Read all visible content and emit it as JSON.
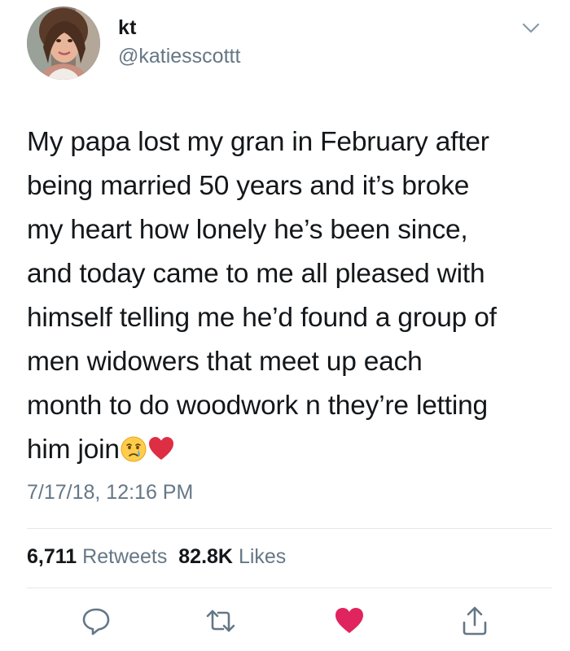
{
  "user": {
    "name": "kt",
    "handle": "@katiesscottt"
  },
  "tweet": {
    "lines": [
      "My papa lost my gran in February after",
      "being married 50 years and it’s broke",
      "my heart how lonely he’s been since,",
      "and today came to me all pleased with",
      "himself telling me he’d found a group of",
      "men widowers that meet up each",
      "month to do woodwork n they’re letting",
      "him join"
    ],
    "emojis": [
      "crying-face",
      "red-heart"
    ],
    "timestamp": "7/17/18, 12:16 PM"
  },
  "stats": {
    "retweets_count": "6,711",
    "retweets_label": "Retweets",
    "likes_count": "82.8K",
    "likes_label": "Likes"
  },
  "actions": {
    "reply_icon": "reply-icon",
    "retweet_icon": "retweet-icon",
    "like_icon": "heart-icon",
    "share_icon": "share-icon",
    "like_active": true
  },
  "colors": {
    "text": "#14171a",
    "secondary": "#657786",
    "icon": "#657786",
    "like": "#e0245e",
    "divider": "#e1e8ed"
  }
}
